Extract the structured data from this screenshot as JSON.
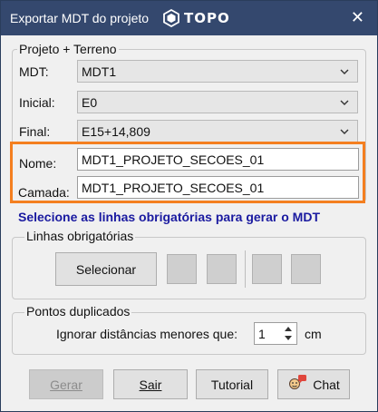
{
  "window": {
    "title": "Exportar MDT do projeto",
    "logo_text": "TOPO",
    "close_symbol": "✕",
    "titlebar_color": "#34486e"
  },
  "project_group": {
    "legend": "Projeto + Terreno",
    "mdt_label": "MDT:",
    "mdt_value": "MDT1",
    "initial_label": "Inicial:",
    "initial_value": "E0",
    "final_label": "Final:",
    "final_value": "E15+14,809"
  },
  "name_label": "Nome:",
  "name_value": "MDT1_PROJETO_SECOES_01",
  "layer_label": "Camada:",
  "layer_value": "MDT1_PROJETO_SECOES_01",
  "highlight_color": "#f47f20",
  "notice": "Selecione as linhas obrigatórias para gerar o MDT",
  "required_lines": {
    "legend": "Linhas obrigatórias",
    "select_button": "Selecionar"
  },
  "duplicates": {
    "legend": "Pontos duplicados",
    "ignore_label": "Ignorar distâncias menores que:",
    "distance_value": "1",
    "unit": "cm"
  },
  "buttons": {
    "generate": "Gerar",
    "exit": "Sair",
    "tutorial": "Tutorial",
    "chat": "Chat"
  },
  "icons": {
    "logo": "topo-logo-icon",
    "chevron": "chevron-down-icon",
    "chat": "chat-icon",
    "spinner": "spinner-arrows-icon"
  }
}
